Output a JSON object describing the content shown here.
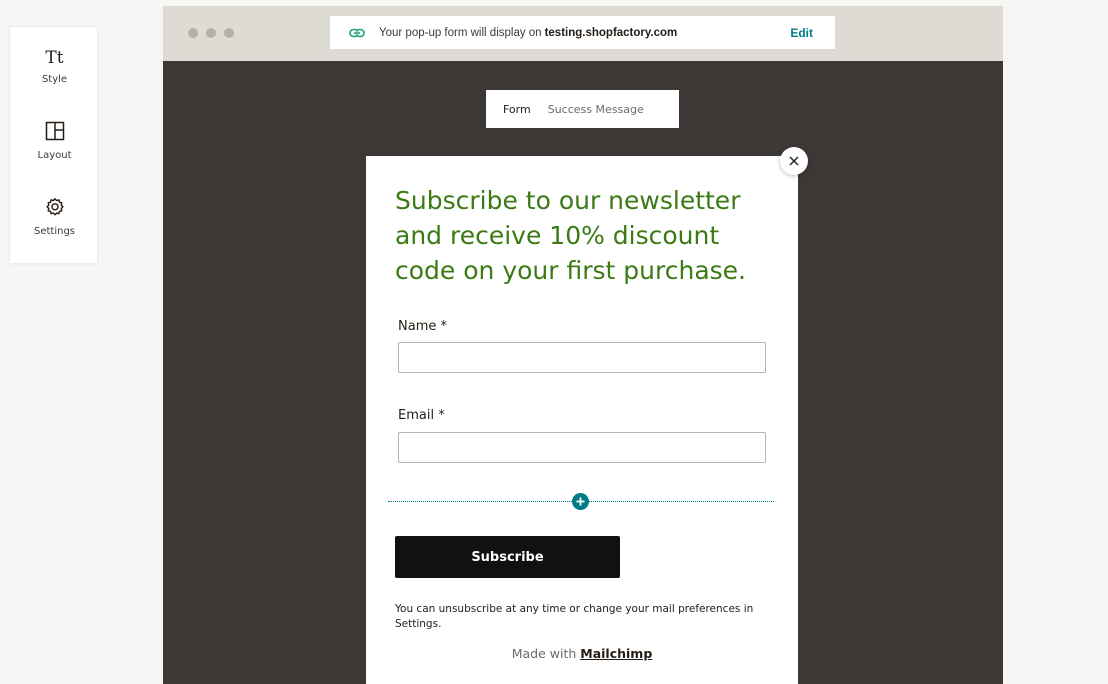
{
  "toolbar": {
    "items": [
      {
        "label": "Style",
        "glyph": "Tt",
        "icon": "text-style-icon"
      },
      {
        "label": "Layout",
        "icon": "layout-icon"
      },
      {
        "label": "Settings",
        "icon": "gear-icon"
      }
    ]
  },
  "browser": {
    "url_prefix": "Your pop-up form will display on",
    "url_domain": "testing.shopfactory.com",
    "edit_label": "Edit",
    "link_icon": "link-icon"
  },
  "tabs": {
    "form": "Form",
    "success": "Success Message"
  },
  "popup": {
    "headline": "Subscribe to our newsletter and receive 10% discount code on your first purchase.",
    "name_label": "Name *",
    "name_value": "",
    "email_label": "Email *",
    "email_value": "",
    "subscribe_label": "Subscribe",
    "disclaimer": "You can unsubscribe at any time or change your mail preferences in Settings.",
    "made_with_prefix": "Made with",
    "made_with_link": "Mailchimp",
    "close_icon": "close-icon",
    "add_icon": "plus-icon"
  },
  "colors": {
    "headline": "#3b7a14",
    "accent": "#007c89",
    "browser_bg": "#3d3836",
    "browser_bar": "#dedbd4",
    "button": "#111111"
  }
}
